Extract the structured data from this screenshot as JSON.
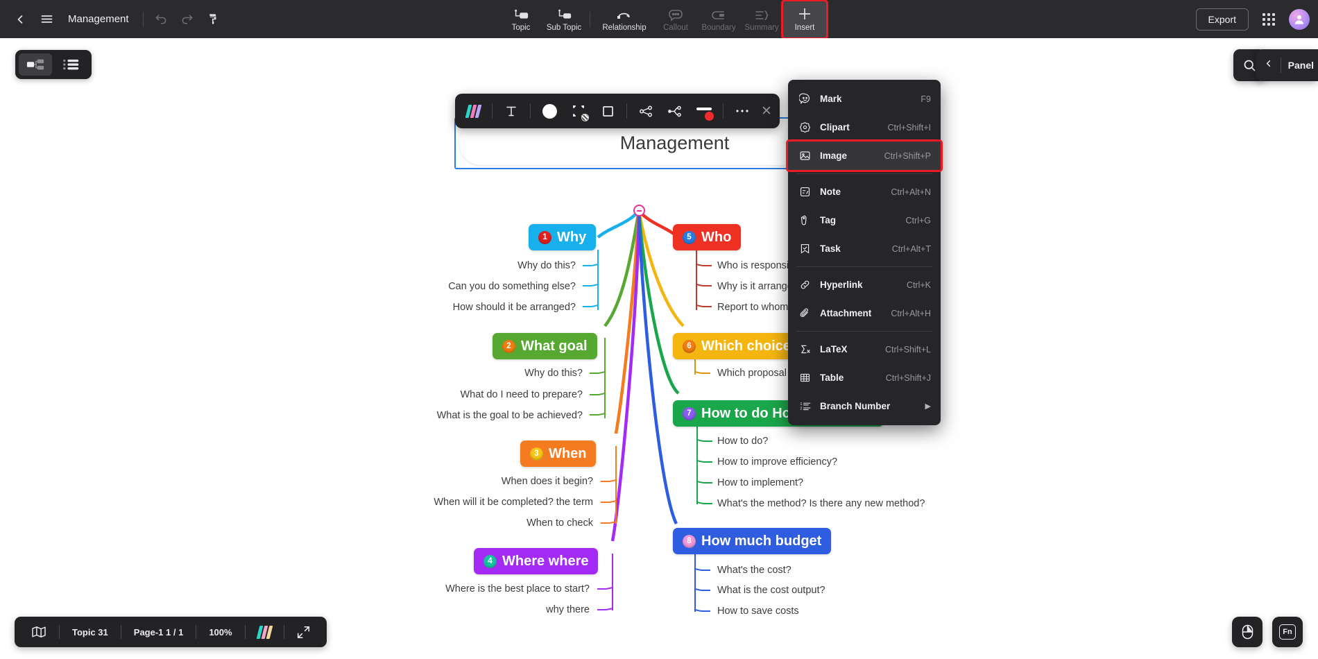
{
  "app": {
    "title": "Management",
    "accent_red": "#ec1c24"
  },
  "topbar": {
    "back_label": "back",
    "menu_label": "menu",
    "undo_label": "undo",
    "redo_label": "redo",
    "format_painter_label": "format painter",
    "tools": [
      {
        "label": "Topic",
        "icon": "topic-icon",
        "disabled": false
      },
      {
        "label": "Sub Topic",
        "icon": "sub-topic-icon",
        "disabled": false
      },
      {
        "label": "Relationship",
        "icon": "relationship-icon",
        "disabled": false
      },
      {
        "label": "Callout",
        "icon": "callout-icon",
        "disabled": true
      },
      {
        "label": "Boundary",
        "icon": "boundary-icon",
        "disabled": true
      },
      {
        "label": "Summary",
        "icon": "summary-icon",
        "disabled": true
      },
      {
        "label": "Insert",
        "icon": "plus-icon",
        "disabled": false
      }
    ],
    "export_label": "Export",
    "apps_label": "apps",
    "avatar_label": "user avatar"
  },
  "view_switch": {
    "mindmap_label": "mind map view",
    "outline_label": "outline view"
  },
  "format_toolbar": {
    "items": [
      {
        "name": "theme-style-icon",
        "label": "Style"
      },
      {
        "name": "text-format-icon",
        "label": "T"
      },
      {
        "name": "fill-color-icon",
        "label": "Fill"
      },
      {
        "name": "shape-icon",
        "label": "Shape"
      },
      {
        "name": "border-icon",
        "label": "Border"
      },
      {
        "name": "branch-layout-icon",
        "label": "Branch layout"
      },
      {
        "name": "branch-structure-icon",
        "label": "Branch structure"
      },
      {
        "name": "line-color-icon",
        "label": "Line color"
      },
      {
        "name": "more-options-icon",
        "label": "..."
      },
      {
        "name": "close-icon",
        "label": "Close"
      }
    ]
  },
  "insert_menu": {
    "items": [
      {
        "label": "Mark",
        "shortcut": "F9",
        "icon": "mark-icon",
        "highlighted": false,
        "divider_after": false,
        "submenu": false
      },
      {
        "label": "Clipart",
        "shortcut": "Ctrl+Shift+I",
        "icon": "clipart-icon",
        "highlighted": false,
        "divider_after": false,
        "submenu": false
      },
      {
        "label": "Image",
        "shortcut": "Ctrl+Shift+P",
        "icon": "image-icon",
        "highlighted": true,
        "divider_after": true,
        "submenu": false
      },
      {
        "label": "Note",
        "shortcut": "Ctrl+Alt+N",
        "icon": "note-icon",
        "highlighted": false,
        "divider_after": false,
        "submenu": false
      },
      {
        "label": "Tag",
        "shortcut": "Ctrl+G",
        "icon": "tag-icon",
        "highlighted": false,
        "divider_after": false,
        "submenu": false
      },
      {
        "label": "Task",
        "shortcut": "Ctrl+Alt+T",
        "icon": "task-icon",
        "highlighted": false,
        "divider_after": true,
        "submenu": false
      },
      {
        "label": "Hyperlink",
        "shortcut": "Ctrl+K",
        "icon": "hyperlink-icon",
        "highlighted": false,
        "divider_after": false,
        "submenu": false
      },
      {
        "label": "Attachment",
        "shortcut": "Ctrl+Alt+H",
        "icon": "attachment-icon",
        "highlighted": false,
        "divider_after": true,
        "submenu": false
      },
      {
        "label": "LaTeX",
        "shortcut": "Ctrl+Shift+L",
        "icon": "latex-icon",
        "highlighted": false,
        "divider_after": false,
        "submenu": false
      },
      {
        "label": "Table",
        "shortcut": "Ctrl+Shift+J",
        "icon": "table-icon",
        "highlighted": false,
        "divider_after": false,
        "submenu": false
      },
      {
        "label": "Branch Number",
        "shortcut": "",
        "icon": "branch-number-icon",
        "highlighted": false,
        "divider_after": false,
        "submenu": true
      }
    ]
  },
  "right_panel": {
    "search_label": "search",
    "panel_label": "Panel",
    "collapse_label": "collapse panel"
  },
  "statusbar": {
    "map_icon_label": "map overview",
    "topic_count": "Topic 31",
    "page": "Page-1  1 / 1",
    "zoom": "100%",
    "theme_label": "theme",
    "fullscreen_label": "fullscreen"
  },
  "bottom_right": {
    "mouse_mode_label": "mouse mode",
    "fn_label": "Fn"
  },
  "mindmap": {
    "root": "Management",
    "branches": [
      {
        "num": "1",
        "title": "Why",
        "color": "#17b0ec",
        "num_color": "#e02020",
        "side": "left",
        "children": [
          "Why do this?",
          "Can you do something else?",
          "How should it be arranged?"
        ]
      },
      {
        "num": "2",
        "title": "What goal",
        "color": "#56a831",
        "num_color": "#f07c12",
        "side": "left",
        "children": [
          "Why do this?",
          "What do I need to prepare?",
          "What is the goal to be achieved?"
        ]
      },
      {
        "num": "3",
        "title": "When",
        "color": "#f57b20",
        "num_color": "#f5c518",
        "side": "left",
        "children": [
          "When does it begin?",
          "When will it be completed? the term",
          "When to check"
        ]
      },
      {
        "num": "4",
        "title": "Where where",
        "color": "#a42bf5",
        "num_color": "#17c4a0",
        "side": "left",
        "children": [
          "Where is the best place to start?",
          "why there"
        ]
      },
      {
        "num": "5",
        "title": "Who",
        "color": "#ef3124",
        "num_color": "#2b7ce0",
        "side": "right",
        "children": [
          "Who is responsible?",
          "Why is it arranged?",
          "Report to whom?"
        ]
      },
      {
        "num": "6",
        "title": "Which choice",
        "color": "#f5b511",
        "num_color": "#f07c12",
        "side": "right",
        "children": [
          "Which proposal is better?"
        ]
      },
      {
        "num": "7",
        "title": "How to do How to execute",
        "color": "#1aa64b",
        "num_color": "#8a5cf0",
        "side": "right",
        "children": [
          "How to do?",
          "How to improve efficiency?",
          "How to implement?",
          "What's the method? Is there any new method?"
        ]
      },
      {
        "num": "8",
        "title": "How much budget",
        "color": "#2f5de0",
        "num_color": "#f098d8",
        "side": "right",
        "children": [
          "What's the cost?",
          "What is the cost output?",
          "How to save costs"
        ]
      }
    ]
  }
}
